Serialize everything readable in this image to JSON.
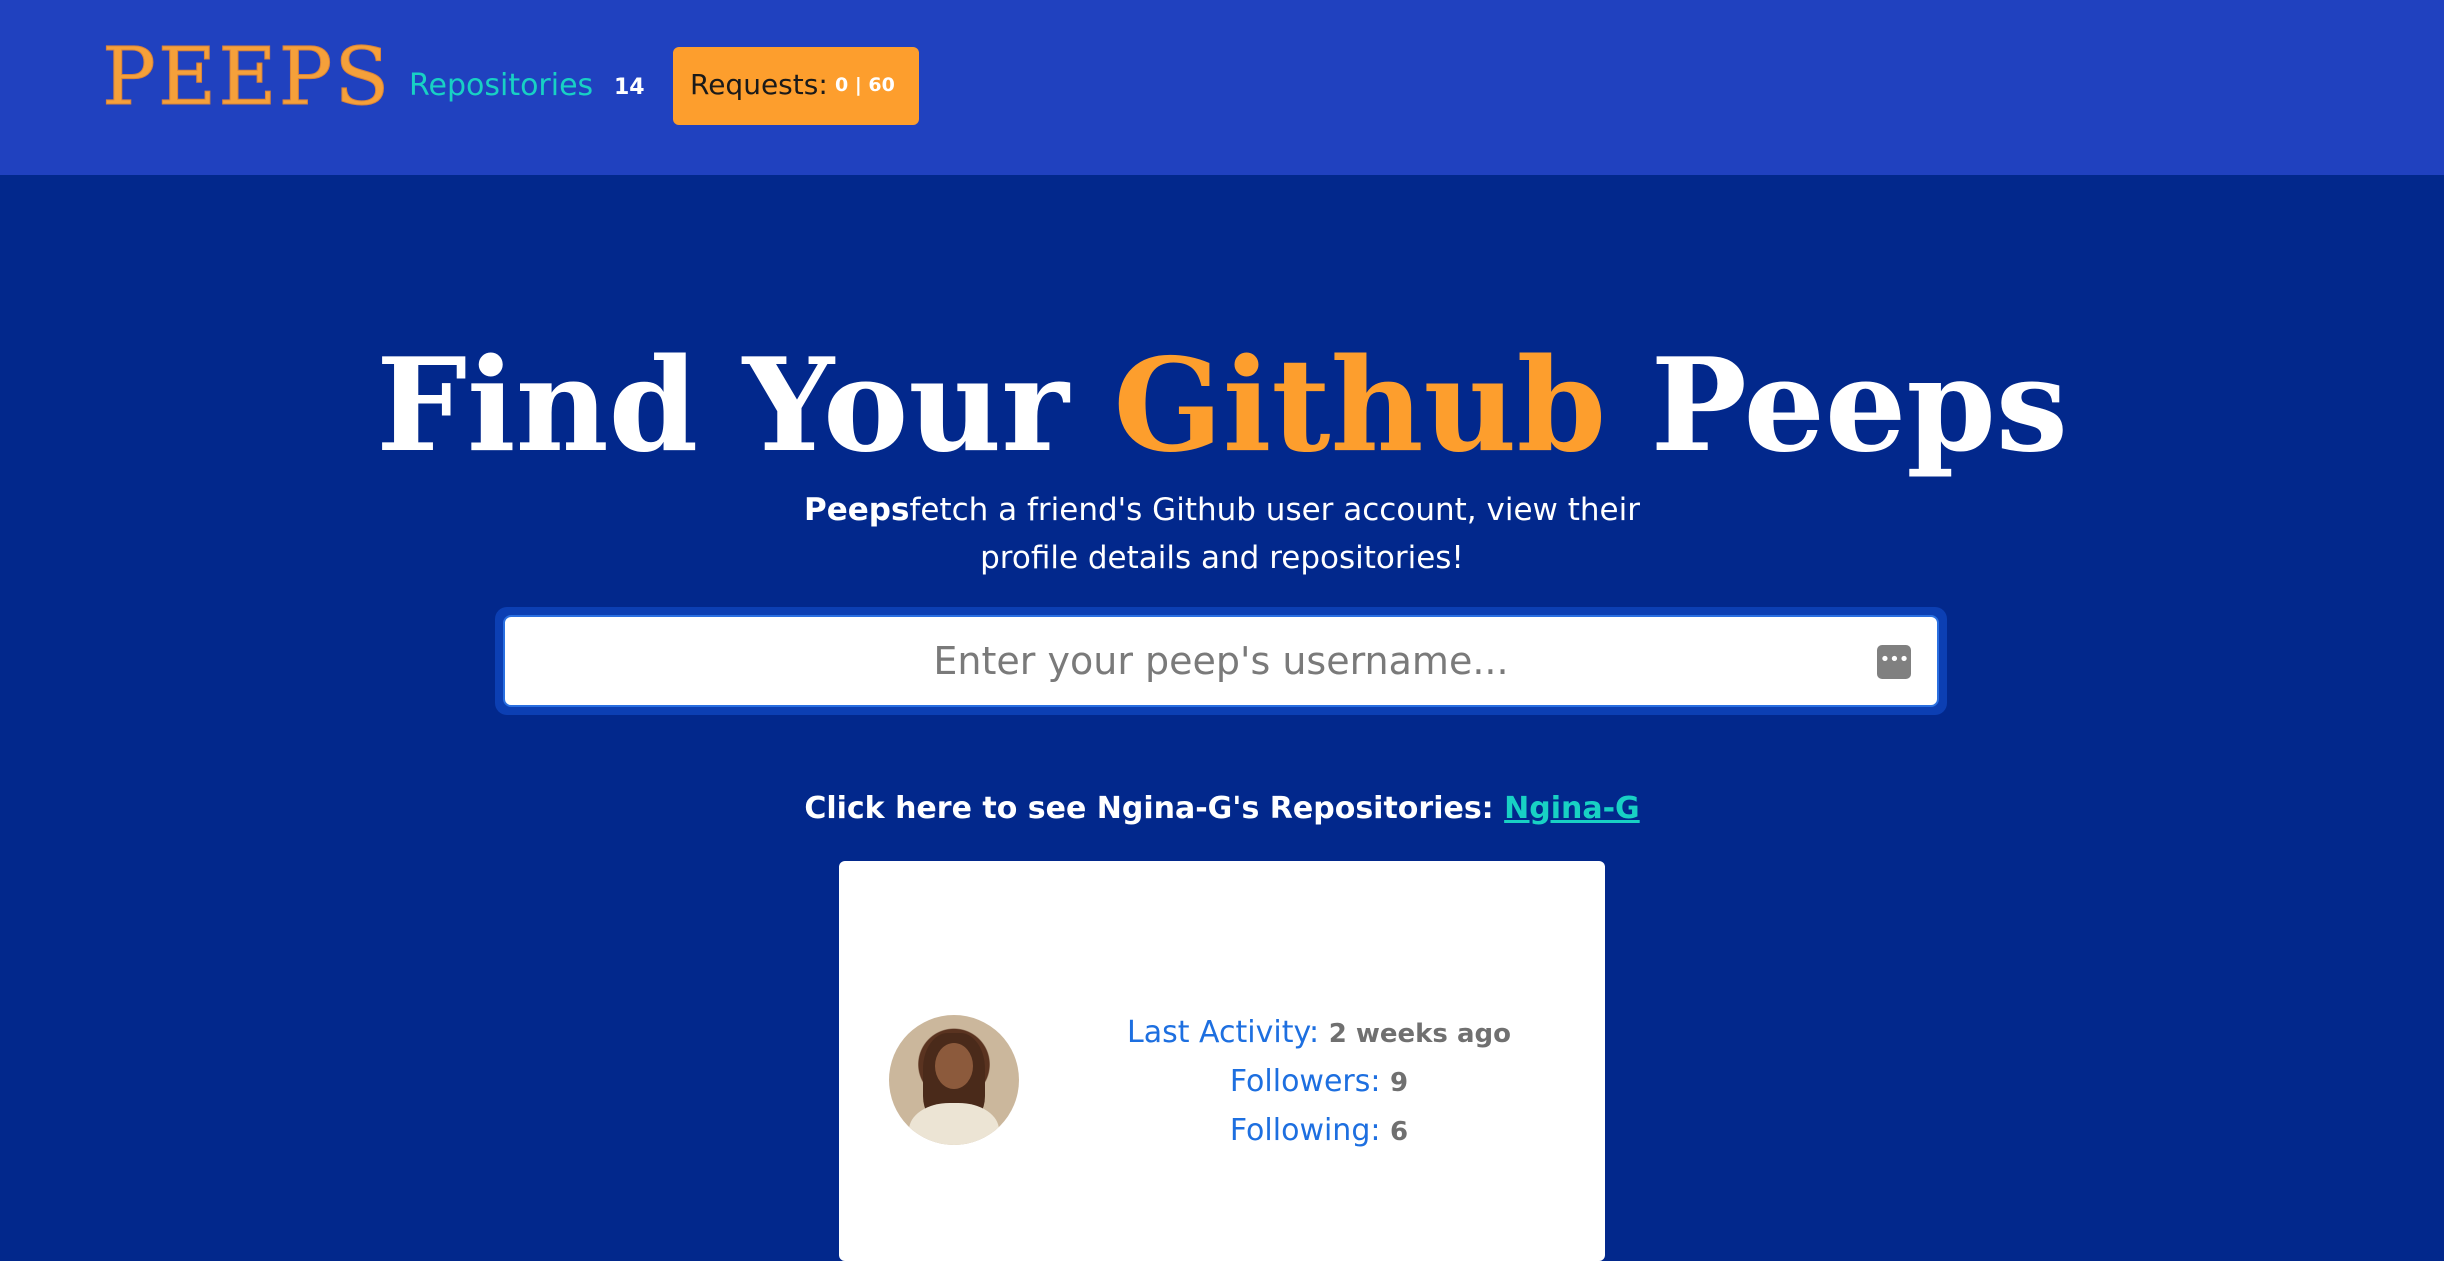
{
  "nav": {
    "brand": "PEEPS",
    "repos_label": "Repositories",
    "repos_count": "14",
    "requests_label": "Requests:",
    "requests_value": "0 | 60"
  },
  "hero": {
    "title_part1": "Find Your ",
    "title_accent": "Github",
    "title_part2": " Peeps",
    "subtitle_bold": "Peeps",
    "subtitle_rest": "fetch a friend's Github user account, view their profile details and repositories!"
  },
  "search": {
    "placeholder": "Enter your peep's username...",
    "value": ""
  },
  "link": {
    "prefix": "Click here to see Ngina-G's Repositories: ",
    "username": "Ngina-G"
  },
  "profile": {
    "last_activity_label": "Last Activity:",
    "last_activity_value": "2 weeks ago",
    "followers_label": "Followers:",
    "followers_value": "9",
    "following_label": "Following:",
    "following_value": "6"
  },
  "colors": {
    "navbar": "#2041bf",
    "background": "#02288c",
    "accent_orange": "#fd9e2d",
    "accent_teal": "#18d1c4",
    "stat_label_blue": "#1d6fe0"
  },
  "icons": {
    "search_extra": "more-dots-icon"
  }
}
